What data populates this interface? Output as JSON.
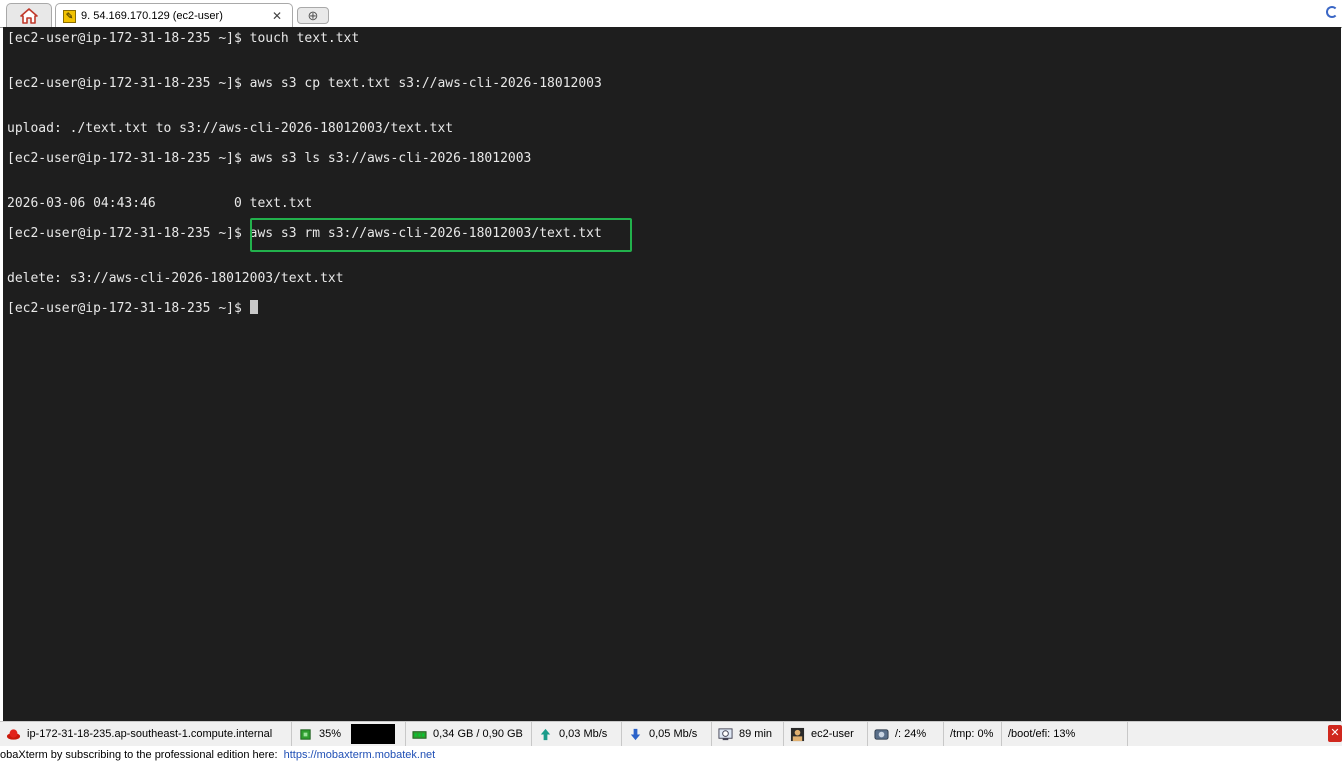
{
  "tabs": {
    "home_icon": "home-icon",
    "session_label": "9. 54.169.170.129 (ec2-user)",
    "session_icon": "wrench-icon",
    "close_symbol": "✕",
    "new_tab_icon": "plus-icon"
  },
  "terminal": {
    "lines": [
      "[ec2-user@ip-172-31-18-235 ~]$ touch text.txt",
      "[ec2-user@ip-172-31-18-235 ~]$ aws s3 cp text.txt s3://aws-cli-2026-18012003",
      "upload: ./text.txt to s3://aws-cli-2026-18012003/text.txt",
      "[ec2-user@ip-172-31-18-235 ~]$ aws s3 ls s3://aws-cli-2026-18012003",
      "2026-03-06 04:43:46          0 text.txt",
      "[ec2-user@ip-172-31-18-235 ~]$ aws s3 rm s3://aws-cli-2026-18012003/text.txt",
      "delete: s3://aws-cli-2026-18012003/text.txt",
      "[ec2-user@ip-172-31-18-235 ~]$ "
    ],
    "highlight_color": "#22b14c"
  },
  "statusbar": {
    "host": "ip-172-31-18-235.ap-southeast-1.compute.internal",
    "cpu": "35%",
    "memory": "0,34 GB / 0,90 GB",
    "upload": "0,03 Mb/s",
    "download": "0,05 Mb/s",
    "uptime": "89 min",
    "user": "ec2-user",
    "disk_root": "/: 24%",
    "disk_tmp": "/tmp: 0%",
    "disk_boot": "/boot/efi: 13%"
  },
  "footer": {
    "text": "obaXterm by subscribing to the professional edition here:",
    "link": "https://mobaxterm.mobatek.net"
  }
}
